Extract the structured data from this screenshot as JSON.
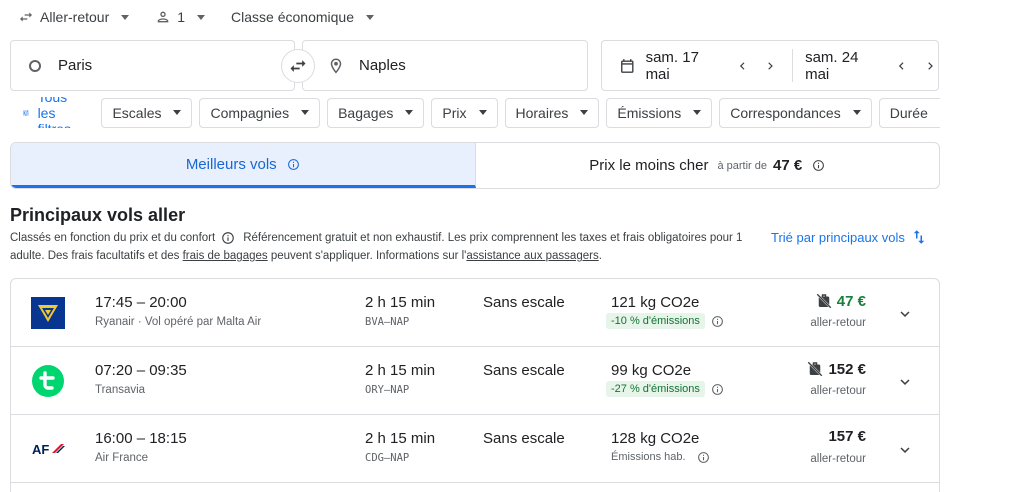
{
  "top": {
    "trip_type": "Aller-retour",
    "passengers": "1",
    "cabin": "Classe économique"
  },
  "search": {
    "origin": "Paris",
    "destination": "Naples",
    "depart_date": "sam. 17 mai",
    "return_date": "sam. 24 mai"
  },
  "filters": {
    "all_label": "Tous les filtres",
    "chips": [
      "Escales",
      "Compagnies",
      "Bagages",
      "Prix",
      "Horaires",
      "Émissions",
      "Correspondances",
      "Durée"
    ]
  },
  "tabs": {
    "best": "Meilleurs vols",
    "cheapest": "Prix le moins cher",
    "from_label": "à partir de",
    "cheapest_price": "47 €"
  },
  "results_header": {
    "title": "Principaux vols aller",
    "desc_1": "Classés en fonction du prix et du confort",
    "desc_2": "Référencement gratuit et non exhaustif. Les prix comprennent les taxes et frais obligatoires pour 1 adulte. Des frais facultatifs et des",
    "link_baggage": "frais de bagages",
    "desc_3": "peuvent s'appliquer. Informations sur l'",
    "link_assist": "assistance aux passagers",
    "desc_4": ".",
    "sort_label": "Trié par principaux vols"
  },
  "flights": [
    {
      "times": "17:45 – 20:00",
      "airline": "Ryanair · Vol opéré par Malta Air",
      "duration": "2 h 15 min",
      "route": "BVA–NAP",
      "stops": "Sans escale",
      "co2": "121 kg CO2e",
      "emissions": "-10 % d'émissions",
      "price": "47 €",
      "price_type": "aller-retour"
    },
    {
      "times": "07:20 – 09:35",
      "airline": "Transavia",
      "duration": "2 h 15 min",
      "route": "ORY–NAP",
      "stops": "Sans escale",
      "co2": "99 kg CO2e",
      "emissions": "-27 % d'émissions",
      "price": "152 €",
      "price_type": "aller-retour"
    },
    {
      "times": "16:00 – 18:15",
      "airline": "Air France",
      "duration": "2 h 15 min",
      "route": "CDG–NAP",
      "stops": "Sans escale",
      "co2": "128 kg CO2e",
      "emissions": "Émissions hab.",
      "price": "157 €",
      "price_type": "aller-retour"
    }
  ],
  "logos": {
    "airfrance_text": "AF"
  },
  "colors": {
    "accent": "#1a73e8",
    "green": "#188038",
    "badge_bg": "#e6f4ea",
    "ryanair_blue": "#073590",
    "ryanair_gold": "#f1c933",
    "transavia_green": "#00d66f",
    "airfrance_blue": "#002157",
    "airfrance_red": "#e0182d"
  }
}
